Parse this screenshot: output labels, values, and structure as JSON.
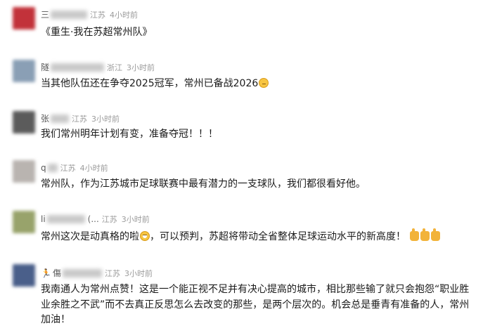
{
  "comments": [
    {
      "user": "三",
      "location": "江苏",
      "time": "4小时前",
      "text": "《重生·我在苏超常州队》",
      "avatar_color": "#c2323a"
    },
    {
      "user": "隧",
      "location": "浙江",
      "time": "3小时前",
      "text": "当其他队伍还在争夺2025冠军，常州已备战2026",
      "emoji": "thinking-face",
      "avatar_color": "#8a9fb5"
    },
    {
      "user": "张",
      "location": "江苏",
      "time": "3小时前",
      "text": "我们常州明年计划有变，准备夺冠！！！",
      "avatar_color": "#5b5b5b"
    },
    {
      "user": "q",
      "location": "江苏",
      "time": "4小时前",
      "text": "常州队，作为江苏城市足球联赛中最有潜力的一支球队，我们都很看好他。",
      "avatar_color": "#b9b4b0"
    },
    {
      "user": "li",
      "extra": "(...",
      "location": "江苏",
      "time": "3小时前",
      "text_before": "常州这次是动真格的啦",
      "text_after": "，可以预判，苏超将带动全省整体足球运动水平的新高度！",
      "emoji": "grinning-face",
      "thumbs": 3,
      "avatar_color": "#98a36b"
    },
    {
      "user": "傷",
      "location": "江苏",
      "time": "3小时前",
      "text": "我南通人为常州点赞！这是一个能正视不足并有决心提高的城市，相比那些输了就只会抱怨“职业胜业余胜之不武”而不去真正反思怎么去改变的那些，是两个层次的。机会总是垂青有准备的人，常州加油！",
      "avatar_color": "#4a5f8a"
    }
  ]
}
